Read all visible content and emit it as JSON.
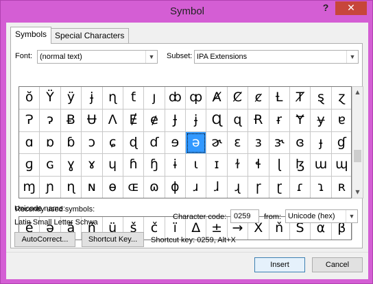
{
  "window": {
    "title": "Symbol",
    "help": "?",
    "close": "✕"
  },
  "tabs": [
    {
      "label": "Symbols"
    },
    {
      "label": "Special Characters"
    }
  ],
  "font": {
    "label": "Font:",
    "value": "(normal text)"
  },
  "subset": {
    "label": "Subset:",
    "value": "IPA Extensions"
  },
  "symbols": [
    [
      "ŏ",
      "Ÿ",
      "ÿ",
      "ɉ",
      "ɳ",
      "ƭ",
      "ȷ",
      "ȸ",
      "ȹ",
      "Ⱥ",
      "Ȼ",
      "ȼ",
      "Ƚ",
      "Ⱦ",
      "ȿ",
      "ɀ"
    ],
    [
      "Ɂ",
      "ɂ",
      "Ƀ",
      "Ʉ",
      "Ʌ",
      "Ɇ",
      "ɇ",
      "Ɉ",
      "ɉ",
      "Ɋ",
      "ɋ",
      "Ɍ",
      "ɍ",
      "Ɏ",
      "ɏ",
      "ɐ"
    ],
    [
      "ɑ",
      "ɒ",
      "ɓ",
      "ɔ",
      "ɕ",
      "ɖ",
      "ɗ",
      "ɘ",
      "ə",
      "ɚ",
      "ɛ",
      "ɜ",
      "ɝ",
      "ɞ",
      "ɟ",
      "ɠ"
    ],
    [
      "ɡ",
      "ɢ",
      "ɣ",
      "ɤ",
      "ɥ",
      "ɦ",
      "ɧ",
      "ɨ",
      "ɩ",
      "ɪ",
      "ɫ",
      "ɬ",
      "ɭ",
      "ɮ",
      "ɯ",
      "ɰ"
    ],
    [
      "ɱ",
      "ɲ",
      "ɳ",
      "ɴ",
      "ɵ",
      "ɶ",
      "ɷ",
      "ɸ",
      "ɹ",
      "ɺ",
      "ɻ",
      "ɼ",
      "ɽ",
      "ɾ",
      "ɿ",
      "ʀ"
    ]
  ],
  "selected_symbol": "ə",
  "recent": {
    "label": "Recently used symbols:",
    "items": [
      "ē",
      "ə",
      "ā",
      "ñ",
      "ü",
      "š",
      "č",
      "ï",
      "Δ",
      "±",
      "→",
      "X",
      "ň",
      "Š",
      "α",
      "β"
    ]
  },
  "unicode": {
    "name_label": "Unicode name:",
    "name_value": "Latin Small Letter Schwa"
  },
  "char_code": {
    "label": "Character code:",
    "value": "0259",
    "from_label": "from:",
    "from_value": "Unicode (hex)"
  },
  "buttons": {
    "autocorrect": "AutoCorrect...",
    "shortcut": "Shortcut Key...",
    "insert": "Insert",
    "cancel": "Cancel"
  },
  "shortcut_text": "Shortcut key: 0259, Alt+X",
  "colors": {
    "title_bar": "#d45ed4",
    "close": "#c7463b",
    "selection": "#3399ff"
  }
}
